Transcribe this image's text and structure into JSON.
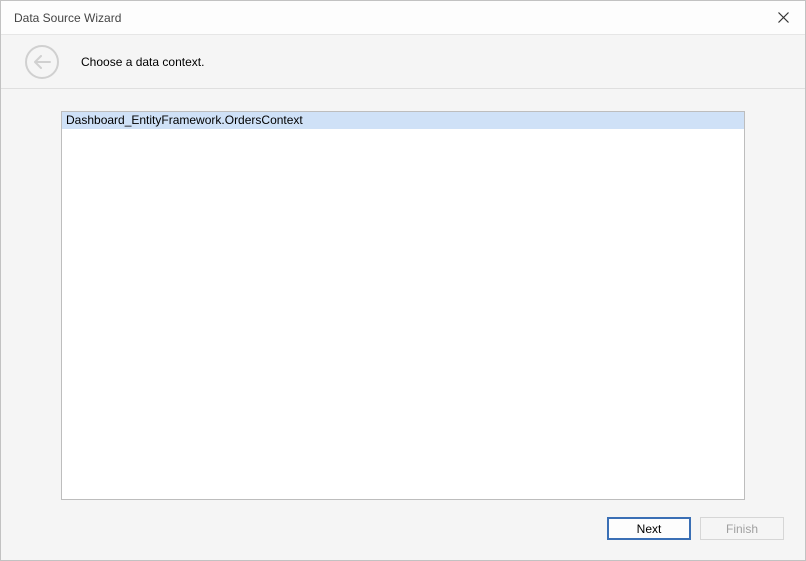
{
  "title": "Data Source Wizard",
  "header": {
    "instruction": "Choose a data context."
  },
  "list": {
    "items": [
      "Dashboard_EntityFramework.OrdersContext"
    ]
  },
  "footer": {
    "next_label": "Next",
    "finish_label": "Finish"
  }
}
